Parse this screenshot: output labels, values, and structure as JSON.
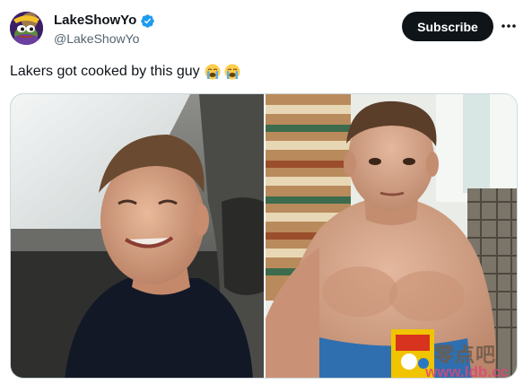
{
  "tweet": {
    "author": {
      "display_name": "LakeShowYo",
      "handle": "@LakeShowYo",
      "verified": true,
      "avatar_icon": "purple-frog-avatar"
    },
    "actions": {
      "subscribe_label": "Subscribe",
      "more_label": "···"
    },
    "text": "Lakers got cooked by this guy",
    "emojis": [
      "loudly-crying-face",
      "loudly-crying-face"
    ],
    "media": {
      "count": 2
    },
    "watermark": {
      "chinese": "零点吧",
      "url": "www.ldb.cc"
    }
  },
  "colors": {
    "verified_badge": "#1d9bf0",
    "subscribe_bg": "#0f1419",
    "subscribe_text": "#ffffff",
    "handle_text": "#536471",
    "watermark_url": "#e0457a"
  }
}
